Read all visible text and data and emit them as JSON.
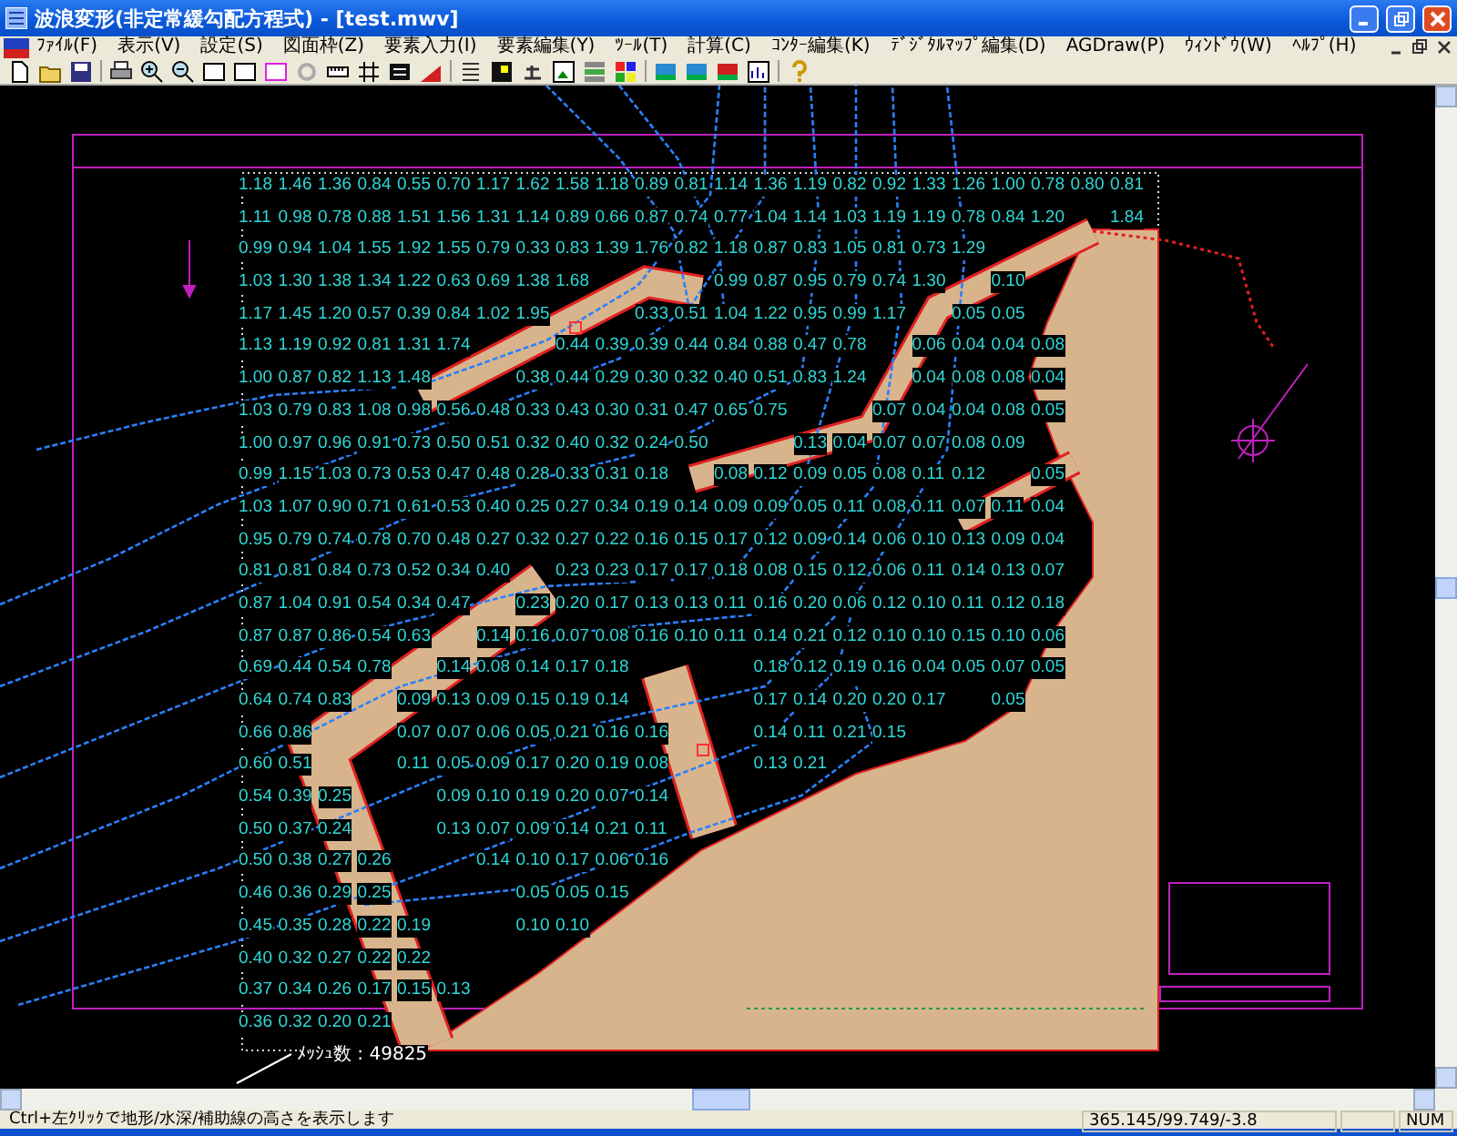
{
  "window": {
    "title": "波浪変形(非定常緩勾配方程式) - [test.mwv]"
  },
  "menu": [
    "ﾌｧｲﾙ(F)",
    "表示(V)",
    "設定(S)",
    "図面枠(Z)",
    "要素入力(I)",
    "要素編集(Y)",
    "ﾂｰﾙ(T)",
    "計算(C)",
    "ｺﾝﾀｰ編集(K)",
    "ﾃﾞｼﾞﾀﾙﾏｯﾌﾟ編集(D)",
    "AGDraw(P)",
    "ｳｨﾝﾄﾞｳ(W)",
    "ﾍﾙﾌﾟ(H)"
  ],
  "map": {
    "grid_rows": [
      [
        "1.18",
        "1.46",
        "1.36",
        "0.84",
        "0.55",
        "0.70",
        "1.17",
        "1.62",
        "1.58",
        "1.18",
        "0.89",
        "0.81",
        "1.14",
        "1.36",
        "1.19",
        "0.82",
        "0.92",
        "1.33",
        "1.26",
        "1.00",
        "0.78",
        "0.80",
        "0.81"
      ],
      [
        "1.11",
        "0.98",
        "0.78",
        "0.88",
        "1.51",
        "1.56",
        "1.31",
        "1.14",
        "0.89",
        "0.66",
        "0.87",
        "0.74",
        "0.77",
        "1.04",
        "1.14",
        "1.03",
        "1.19",
        "1.19",
        "0.78",
        "0.84",
        "1.20",
        null,
        "1.84"
      ],
      [
        "0.99",
        "0.94",
        "1.04",
        "1.55",
        "1.92",
        "1.55",
        "0.79",
        "0.33",
        "0.83",
        "1.39",
        "1.76",
        "0.82",
        "1.18",
        "0.87",
        "0.83",
        "1.05",
        "0.81",
        "0.73",
        "1.29"
      ],
      [
        "1.03",
        "1.30",
        "1.38",
        "1.34",
        "1.22",
        "0.63",
        "0.69",
        "1.38",
        "1.68",
        null,
        null,
        null,
        "0.99",
        "0.87",
        "0.95",
        "0.79",
        "0.74",
        "1.30",
        null,
        "0.10"
      ],
      [
        "1.17",
        "1.45",
        "1.20",
        "0.57",
        "0.39",
        "0.84",
        "1.02",
        "1.95",
        null,
        null,
        "0.33",
        "0.51",
        "1.04",
        "1.22",
        "0.95",
        "0.99",
        "1.17",
        null,
        "0.05",
        "0.05"
      ],
      [
        "1.13",
        "1.19",
        "0.92",
        "0.81",
        "1.31",
        "1.74",
        null,
        null,
        "0.44",
        "0.39",
        "0.39",
        "0.44",
        "0.84",
        "0.88",
        "0.47",
        "0.78",
        null,
        "0.06",
        "0.04",
        "0.04",
        "0.08"
      ],
      [
        "1.00",
        "0.87",
        "0.82",
        "1.13",
        "1.48",
        null,
        null,
        "0.38",
        "0.44",
        "0.29",
        "0.30",
        "0.32",
        "0.40",
        "0.51",
        "0.83",
        "1.24",
        null,
        "0.04",
        "0.08",
        "0.08",
        "0.04"
      ],
      [
        "1.03",
        "0.79",
        "0.83",
        "1.08",
        "0.98",
        "0.56",
        "0.48",
        "0.33",
        "0.43",
        "0.30",
        "0.31",
        "0.47",
        "0.65",
        "0.75",
        null,
        null,
        "0.07",
        "0.04",
        "0.04",
        "0.08",
        "0.05"
      ],
      [
        "1.00",
        "0.97",
        "0.96",
        "0.91",
        "0.73",
        "0.50",
        "0.51",
        "0.32",
        "0.40",
        "0.32",
        "0.24",
        "0.50",
        null,
        null,
        "0.13",
        "0.04",
        "0.07",
        "0.07",
        "0.08",
        "0.09"
      ],
      [
        "0.99",
        "1.15",
        "1.03",
        "0.73",
        "0.53",
        "0.47",
        "0.48",
        "0.28",
        "0.33",
        "0.31",
        "0.18",
        null,
        "0.08",
        "0.12",
        "0.09",
        "0.05",
        "0.08",
        "0.11",
        "0.12",
        null,
        "0.05"
      ],
      [
        "1.03",
        "1.07",
        "0.90",
        "0.71",
        "0.61",
        "0.53",
        "0.40",
        "0.25",
        "0.27",
        "0.34",
        "0.19",
        "0.14",
        "0.09",
        "0.09",
        "0.05",
        "0.11",
        "0.08",
        "0.11",
        "0.07",
        "0.11",
        "0.04"
      ],
      [
        "0.95",
        "0.79",
        "0.74",
        "0.78",
        "0.70",
        "0.48",
        "0.27",
        "0.32",
        "0.27",
        "0.22",
        "0.16",
        "0.15",
        "0.17",
        "0.12",
        "0.09",
        "0.14",
        "0.06",
        "0.10",
        "0.13",
        "0.09",
        "0.04"
      ],
      [
        "0.81",
        "0.81",
        "0.84",
        "0.73",
        "0.52",
        "0.34",
        "0.40",
        null,
        "0.23",
        "0.23",
        "0.17",
        "0.17",
        "0.18",
        "0.08",
        "0.15",
        "0.12",
        "0.06",
        "0.11",
        "0.14",
        "0.13",
        "0.07"
      ],
      [
        "0.87",
        "1.04",
        "0.91",
        "0.54",
        "0.34",
        "0.47",
        null,
        "0.23",
        "0.20",
        "0.17",
        "0.13",
        "0.13",
        "0.11",
        "0.16",
        "0.20",
        "0.06",
        "0.12",
        "0.10",
        "0.11",
        "0.12",
        "0.18"
      ],
      [
        "0.87",
        "0.87",
        "0.86",
        "0.54",
        "0.63",
        null,
        "0.14",
        "0.16",
        "0.07",
        "0.08",
        "0.16",
        "0.10",
        "0.11",
        "0.14",
        "0.21",
        "0.12",
        "0.10",
        "0.10",
        "0.15",
        "0.10",
        "0.06"
      ],
      [
        "0.69",
        "0.44",
        "0.54",
        "0.78",
        null,
        "0.14",
        "0.08",
        "0.14",
        "0.17",
        "0.18",
        null,
        null,
        null,
        "0.18",
        "0.12",
        "0.19",
        "0.16",
        "0.04",
        "0.05",
        "0.07",
        "0.05"
      ],
      [
        "0.64",
        "0.74",
        "0.83",
        null,
        "0.09",
        "0.13",
        "0.09",
        "0.15",
        "0.19",
        "0.14",
        null,
        null,
        null,
        "0.17",
        "0.14",
        "0.20",
        "0.20",
        "0.17",
        null,
        "0.05"
      ],
      [
        "0.66",
        "0.86",
        null,
        null,
        "0.07",
        "0.07",
        "0.06",
        "0.05",
        "0.21",
        "0.16",
        "0.16",
        null,
        null,
        "0.14",
        "0.11",
        "0.21",
        "0.15"
      ],
      [
        "0.60",
        "0.51",
        null,
        null,
        "0.11",
        "0.05",
        "0.09",
        "0.17",
        "0.20",
        "0.19",
        "0.08",
        null,
        null,
        "0.13",
        "0.21"
      ],
      [
        "0.54",
        "0.39",
        "0.25",
        null,
        null,
        "0.09",
        "0.10",
        "0.19",
        "0.20",
        "0.07",
        "0.14"
      ],
      [
        "0.50",
        "0.37",
        "0.24",
        null,
        null,
        "0.13",
        "0.07",
        "0.09",
        "0.14",
        "0.21",
        "0.11"
      ],
      [
        "0.50",
        "0.38",
        "0.27",
        "0.26",
        null,
        null,
        "0.14",
        "0.10",
        "0.17",
        "0.06",
        "0.16"
      ],
      [
        "0.46",
        "0.36",
        "0.29",
        "0.25",
        null,
        null,
        null,
        "0.05",
        "0.05",
        "0.15"
      ],
      [
        "0.45",
        "0.35",
        "0.28",
        "0.22",
        "0.19",
        null,
        null,
        "0.10",
        "0.10"
      ],
      [
        "0.40",
        "0.32",
        "0.27",
        "0.22",
        "0.22"
      ],
      [
        "0.37",
        "0.34",
        "0.26",
        "0.17",
        "0.15",
        "0.13"
      ],
      [
        "0.36",
        "0.32",
        "0.20",
        "0.21"
      ]
    ],
    "mesh_count": "ﾒｯｼｭ数 : 49825"
  },
  "status_bar": {
    "message": "Ctrl+左ｸﾘｯｸで地形/水深/補助線の高さを表示します",
    "coordinates": "365.145/99.749/-3.8",
    "indicator": "NUM"
  }
}
